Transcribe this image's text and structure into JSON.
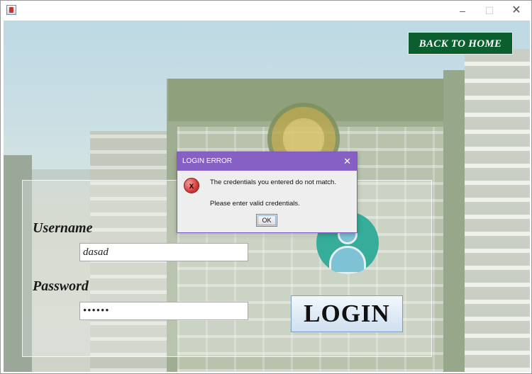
{
  "window": {
    "controls": {
      "minimize": "–",
      "maximize": "☐",
      "close": "✕"
    }
  },
  "header": {
    "back_home_label": "BACK TO HOME"
  },
  "form": {
    "username_label": "Username",
    "username_value": "dasad",
    "password_label": "Password",
    "password_value": "••••••",
    "login_label": "LOGIN"
  },
  "dialog": {
    "title": "LOGIN ERROR",
    "close": "✕",
    "icon": "error-icon",
    "icon_glyph": "x",
    "message_line1": "The credentials you entered do not match.",
    "message_line2": "Please enter valid credentials.",
    "ok_label": "OK"
  },
  "colors": {
    "back_home_bg": "#0b5e2e",
    "dialog_titlebar": "#8660c5",
    "avatar_bg": "#36ad9a"
  }
}
